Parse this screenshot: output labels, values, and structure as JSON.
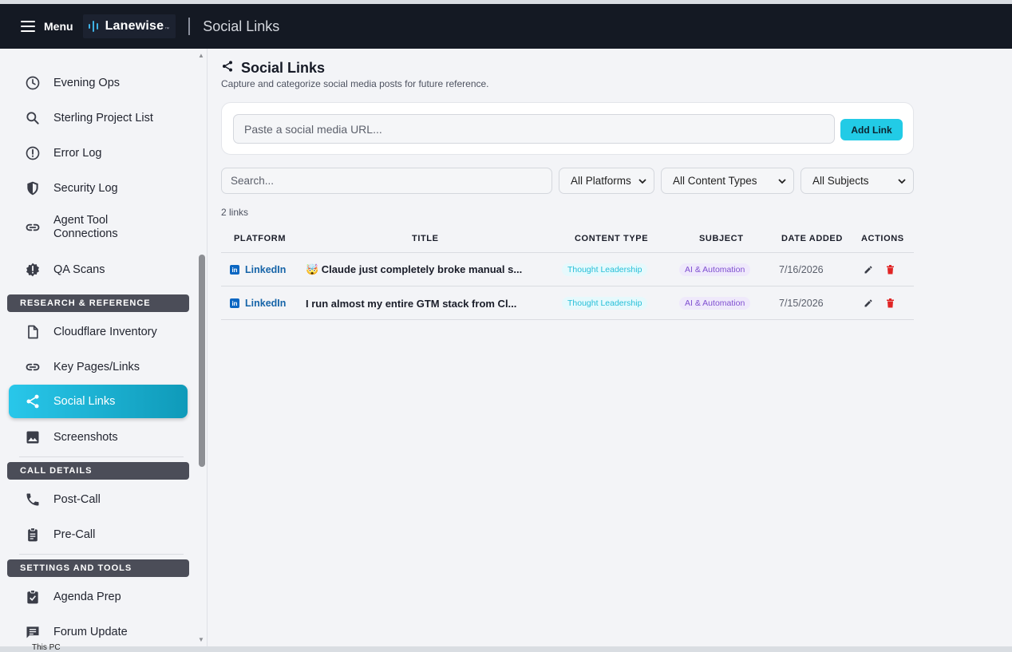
{
  "topbar": {
    "menu_label": "Menu",
    "logo_text": "Lanewise",
    "logo_tm": "™",
    "page_title": "Social Links"
  },
  "sidebar": {
    "items_top": [
      {
        "label": "Evening Ops",
        "icon": "clock-icon"
      },
      {
        "label": "Sterling Project List",
        "icon": "search-icon"
      },
      {
        "label": "Error Log",
        "icon": "alert-circle-icon"
      },
      {
        "label": "Security Log",
        "icon": "shield-icon"
      },
      {
        "label": "Agent Tool Connections",
        "icon": "link-icon"
      },
      {
        "label": "QA Scans",
        "icon": "gear-badge-icon"
      }
    ],
    "section_research": "RESEARCH & REFERENCE",
    "items_research": [
      {
        "label": "Cloudflare Inventory",
        "icon": "document-icon"
      },
      {
        "label": "Key Pages/Links",
        "icon": "link-icon"
      },
      {
        "label": "Social Links",
        "icon": "share-icon",
        "active": true
      },
      {
        "label": "Screenshots",
        "icon": "image-icon"
      }
    ],
    "section_call": "CALL DETAILS",
    "items_call": [
      {
        "label": "Post-Call",
        "icon": "phone-icon"
      },
      {
        "label": "Pre-Call",
        "icon": "clipboard-icon"
      }
    ],
    "section_settings": "SETTINGS AND TOOLS",
    "items_settings": [
      {
        "label": "Agenda Prep",
        "icon": "clipboard-check-icon"
      },
      {
        "label": "Forum Update",
        "icon": "message-icon"
      }
    ]
  },
  "main": {
    "title": "Social Links",
    "subtitle": "Capture and categorize social media posts for future reference.",
    "url_placeholder": "Paste a social media URL...",
    "add_button": "Add Link",
    "search_placeholder": "Search...",
    "filters": {
      "platforms": "All Platforms",
      "content_types": "All Content Types",
      "subjects": "All Subjects"
    },
    "count": "2 links",
    "columns": [
      "PLATFORM",
      "TITLE",
      "CONTENT TYPE",
      "SUBJECT",
      "DATE ADDED",
      "ACTIONS"
    ],
    "rows": [
      {
        "platform": "LinkedIn",
        "title": "🤯 Claude just completely broke manual s...",
        "content_type": "Thought Leadership",
        "subject": "AI & Automation",
        "date": "7/16/2026"
      },
      {
        "platform": "LinkedIn",
        "title": "I run almost my entire GTM stack from Cl...",
        "content_type": "Thought Leadership",
        "subject": "AI & Automation",
        "date": "7/15/2026"
      }
    ]
  },
  "taskbar": {
    "this_pc": "This PC"
  },
  "colors": {
    "accent": "#22cbe6",
    "topbar": "#141923",
    "linkedin": "#0b66c2",
    "delete": "#e02424"
  }
}
